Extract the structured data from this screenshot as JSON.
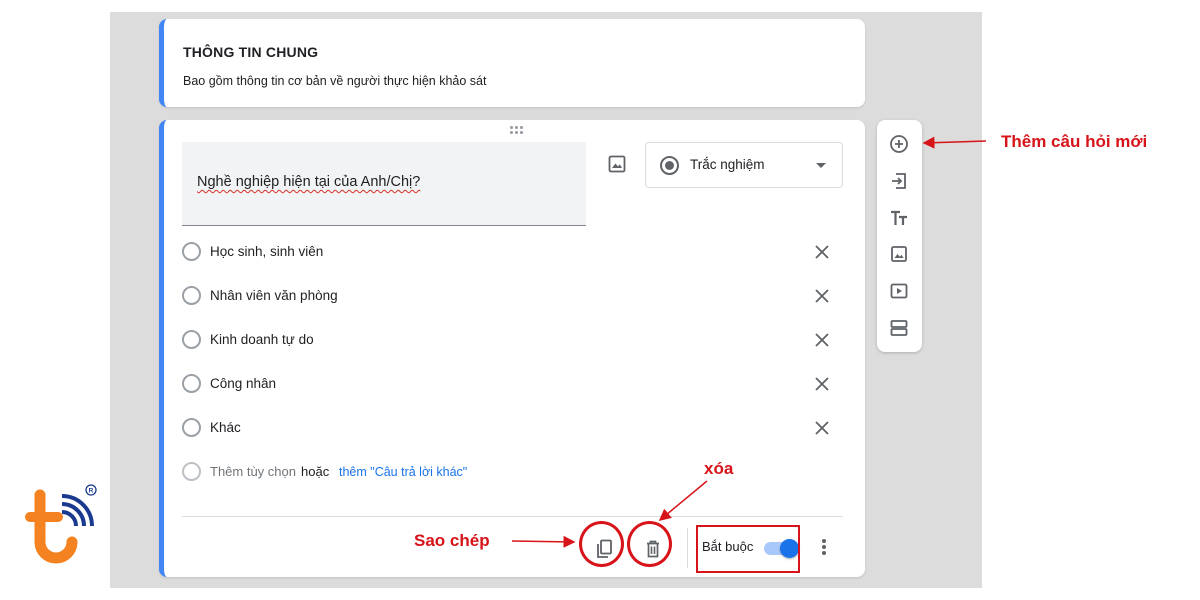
{
  "header": {
    "title": "THÔNG TIN CHUNG",
    "description": "Bao gồm thông tin cơ bản về người thực hiện khảo sát"
  },
  "question": {
    "text": "Nghề nghiệp hiện tại của Anh/Chị?",
    "type_label": "Trắc nghiệm",
    "options": [
      {
        "label": "Học sinh, sinh viên"
      },
      {
        "label": "Nhân viên văn phòng"
      },
      {
        "label": "Kinh doanh tự do"
      },
      {
        "label": "Công nhân"
      },
      {
        "label": "Khác"
      }
    ],
    "add_option_label": "Thêm tùy chọn",
    "or_label": "hoặc",
    "add_other_label": "thêm \"Câu trả lời khác\"",
    "required_label": "Bắt buộc",
    "required_on": true
  },
  "toolbar": {
    "items": [
      "add-question-icon",
      "import-question-icon",
      "add-title-icon",
      "add-image-icon",
      "add-video-icon",
      "add-section-icon"
    ]
  },
  "annotations": {
    "add_question": "Thêm câu hỏi mới",
    "copy": "Sao chép",
    "delete": "xóa"
  },
  "colors": {
    "accent": "#4285f4",
    "toggle": "#1a73e8",
    "link": "#1a73e8",
    "annotation": "#d7141a",
    "logo_orange": "#f58220",
    "logo_blue": "#1a3a8f"
  }
}
